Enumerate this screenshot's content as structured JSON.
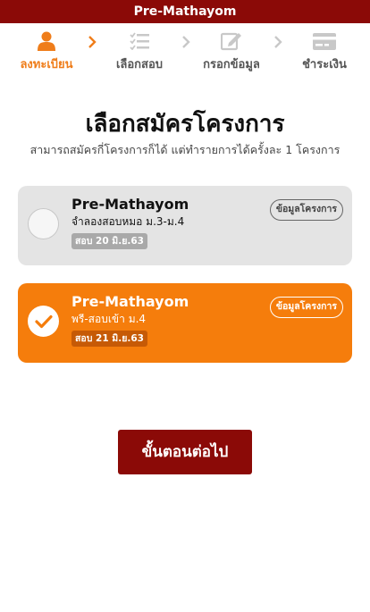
{
  "header": {
    "title": "Pre-Mathayom"
  },
  "steps": [
    {
      "label": "ลงทะเบียน",
      "icon": "user-icon",
      "active": true
    },
    {
      "label": "เลือกสอบ",
      "icon": "checklist-icon",
      "active": false
    },
    {
      "label": "กรอกข้อมูล",
      "icon": "edit-icon",
      "active": false
    },
    {
      "label": "ชำระเงิน",
      "icon": "credit-card-icon",
      "active": false
    }
  ],
  "page": {
    "heading": "เลือกสมัครโครงการ",
    "subheading": "สามารถสมัครกี่โครงการก็ได้ แต่ทำรายการได้ครั้งละ 1 โครงการ"
  },
  "programs": [
    {
      "title": "Pre-Mathayom",
      "subtitle": "จำลองสอบหมอ ม.3-ม.4",
      "date": "สอบ 20 มิ.ย.63",
      "info_label": "ข้อมูลโครงการ",
      "selected": false
    },
    {
      "title": "Pre-Mathayom",
      "subtitle": "พรี-สอบเข้า ม.4",
      "date": "สอบ 21 มิ.ย.63",
      "info_label": "ข้อมูลโครงการ",
      "selected": true
    }
  ],
  "actions": {
    "next_label": "ขั้นตอนต่อไป"
  },
  "colors": {
    "brand_dark_red": "#8b0a07",
    "accent_orange": "#f57d0c",
    "step_active": "#ef7d1a",
    "step_inactive": "#c8c8c8"
  }
}
